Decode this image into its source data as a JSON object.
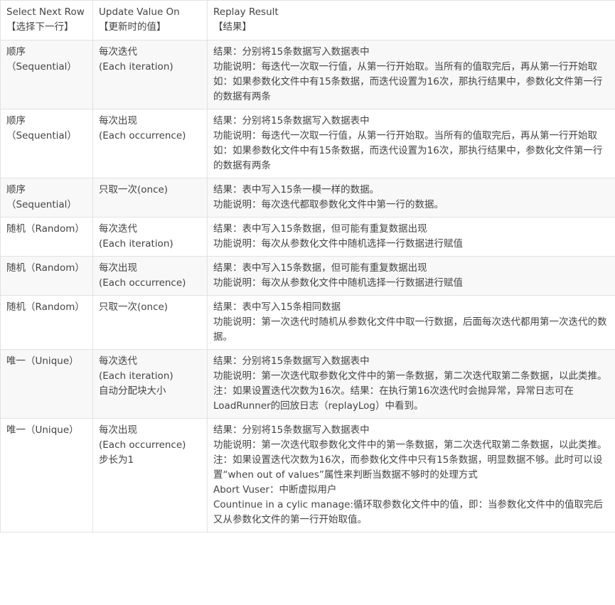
{
  "headers": [
    {
      "en": "Select Next Row",
      "zh": "【选择下一行】"
    },
    {
      "en": "Update Value On",
      "zh": "【更新时的值】"
    },
    {
      "en": "Replay Result",
      "zh": "【结果】"
    }
  ],
  "rows": [
    {
      "col1": [
        "顺序",
        "（Sequential）"
      ],
      "col2": [
        "每次迭代",
        "(Each iteration)"
      ],
      "col3": [
        "结果：分别将15条数据写入数据表中",
        "功能说明：每迭代一次取一行值，从第一行开始取。当所有的值取完后，再从第一行开始取",
        "如：如果参数化文件中有15条数据，而迭代设置为16次，那执行结果中，参数化文件第一行的数据有两条"
      ]
    },
    {
      "col1": [
        "顺序",
        "（Sequential）"
      ],
      "col2": [
        "每次出现",
        "(Each occurrence)"
      ],
      "col3": [
        "结果：分别将15条数据写入数据表中",
        "功能说明：每迭代一次取一行值，从第一行开始取。当所有的值取完后，再从第一行开始取",
        "如：如果参数化文件中有15条数据，而迭代设置为16次，那执行结果中，参数化文件第一行的数据有两条"
      ]
    },
    {
      "col1": [
        "顺序",
        "（Sequential）"
      ],
      "col2": [
        "只取一次(once)"
      ],
      "col3": [
        "结果：表中写入15条一模一样的数据。",
        "功能说明：每次迭代都取参数化文件中第一行的数据。"
      ]
    },
    {
      "col1": [
        "随机（Random）"
      ],
      "col2": [
        "每次迭代",
        "(Each iteration)"
      ],
      "col3": [
        "结果：表中写入15条数据，但可能有重复数据出现",
        "功能说明：每次从参数化文件中随机选择一行数据进行赋值"
      ]
    },
    {
      "col1": [
        "随机（Random）"
      ],
      "col2": [
        "每次出现",
        "(Each occurrence)"
      ],
      "col3": [
        "结果：表中写入15条数据，但可能有重复数据出现",
        "功能说明：每次从参数化文件中随机选择一行数据进行赋值"
      ]
    },
    {
      "col1": [
        "随机（Random）"
      ],
      "col2": [
        "只取一次(once)"
      ],
      "col3": [
        "结果：表中写入15条相同数据",
        "功能说明：第一次迭代时随机从参数化文件中取一行数据，后面每次迭代都用第一次迭代的数据。"
      ]
    },
    {
      "col1": [
        "唯一（Unique）"
      ],
      "col2": [
        "每次迭代",
        "(Each iteration)",
        "自动分配块大小"
      ],
      "col3": [
        "结果：分别将15条数据写入数据表中",
        "功能说明：第一次迭代取参数化文件中的第一条数据，第二次迭代取第二条数据，以此类推。",
        "注：如果设置迭代次数为16次。结果：在执行第16次迭代时会抛异常，异常日志可在LoadRunner的回放日志（replayLog）中看到。"
      ]
    },
    {
      "col1": [
        "唯一（Unique）"
      ],
      "col2": [
        "每次出现",
        "(Each occurrence)",
        "步长为1"
      ],
      "col3": [
        "结果：分别将15条数据写入数据表中",
        "功能说明：第一次迭代取参数化文件中的第一条数据，第二次迭代取第二条数据，以此类推。",
        "注：如果设置迭代次数为16次，而参数化文件中只有15条数据，明显数据不够。此时可以设置“when out of values”属性来判断当数据不够时的处理方式",
        "Abort Vuser：中断虚拟用户",
        "Countinue in a cylic manage:循环取参数化文件中的值，即：当参数化文件中的值取完后又从参数化文件的第一行开始取值。"
      ]
    }
  ]
}
